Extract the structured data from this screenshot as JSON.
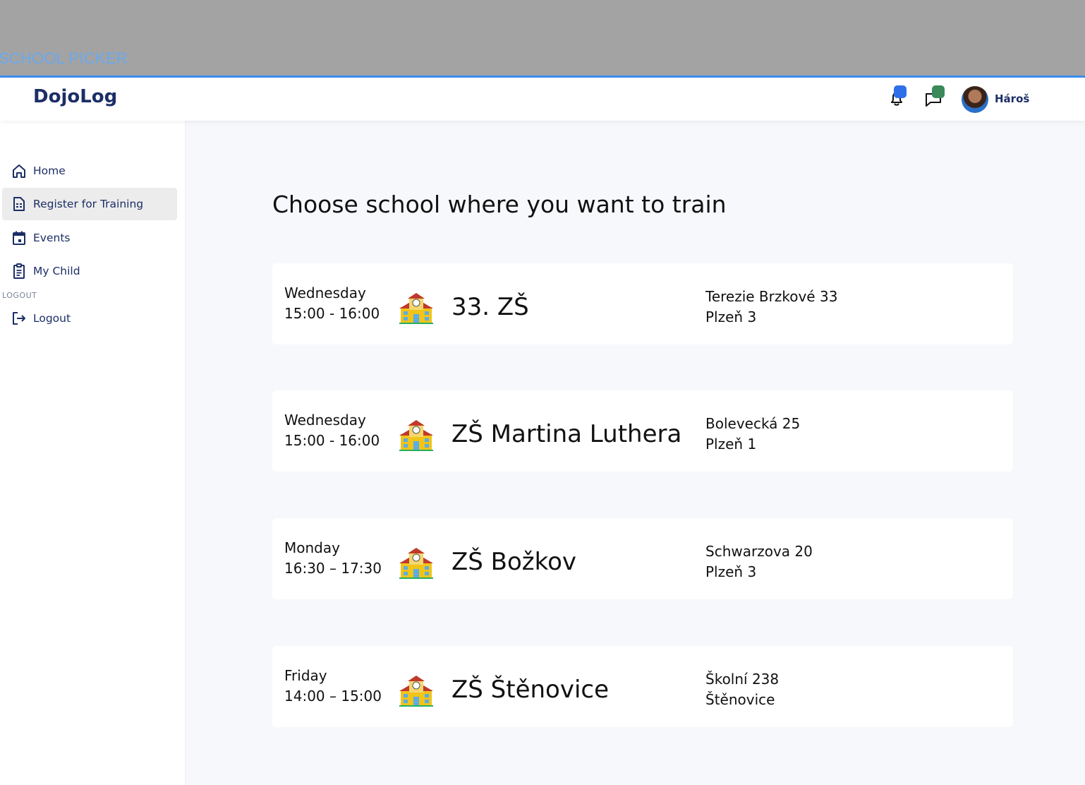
{
  "banner": {
    "title": "SCHOOL PICKER"
  },
  "header": {
    "logo": "DojoLog",
    "username": "Hároš",
    "notification_badge_color": "#2f6fe8",
    "message_badge_color": "#3a8a5a"
  },
  "sidebar": {
    "items": [
      {
        "label": "Home",
        "icon": "home-icon"
      },
      {
        "label": "Register for Training",
        "icon": "document-icon",
        "active": true
      },
      {
        "label": "Events",
        "icon": "calendar-icon"
      },
      {
        "label": "My Child",
        "icon": "clipboard-icon"
      }
    ],
    "section_label": "LOGOUT",
    "logout_label": "Logout"
  },
  "main": {
    "title": "Choose school where you want to train",
    "schools": [
      {
        "day": "Wednesday",
        "time": "15:00 - 16:00",
        "name": "33. ZŠ",
        "street": "Terezie Brzkové 33",
        "city": "Plzeň 3"
      },
      {
        "day": "Wednesday",
        "time": "15:00 - 16:00",
        "name": "ZŠ Martina Luthera",
        "street": "Bolevecká 25",
        "city": "Plzeň 1"
      },
      {
        "day": "Monday",
        "time": "16:30 – 17:30",
        "name": "ZŠ Božkov",
        "street": "Schwarzova 20",
        "city": "Plzeň 3"
      },
      {
        "day": "Friday",
        "time": "14:00 – 15:00",
        "name": "ZŠ Štěnovice",
        "street": "Školní 238",
        "city": "Štěnovice"
      }
    ]
  }
}
